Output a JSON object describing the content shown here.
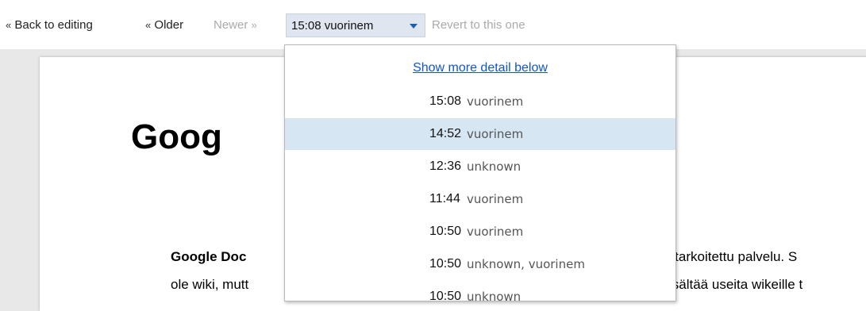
{
  "toolbar": {
    "back_label": "Back to editing",
    "back_arrow": "«",
    "older_label": "Older",
    "older_arrow": "«",
    "newer_label": "Newer",
    "newer_arrow": "»",
    "selected_revision": "15:08 vuorinem",
    "revert_label": "Revert to this one"
  },
  "dropdown": {
    "more_detail_label": "Show more detail below",
    "items": [
      {
        "time": "15:08",
        "who": "vuorinem",
        "highlighted": false
      },
      {
        "time": "14:52",
        "who": "vuorinem",
        "highlighted": true
      },
      {
        "time": "12:36",
        "who": "unknown",
        "highlighted": false
      },
      {
        "time": "11:44",
        "who": "vuorinem",
        "highlighted": false
      },
      {
        "time": "10:50",
        "who": "vuorinem",
        "highlighted": false
      },
      {
        "time": "10:50",
        "who": "unknown, vuorinem",
        "highlighted": false
      },
      {
        "time": "10:50",
        "who": "unknown",
        "highlighted": false
      }
    ]
  },
  "document": {
    "title_visible": "Goog",
    "line1_bold": "Google Doc",
    "line1_right": "n tarkoitettu palvelu. S",
    "line2_left": "ole wiki, mutt",
    "line2_right": "isältää useita wikeille t"
  },
  "colors": {
    "highlight": "#d6e6f3",
    "link": "#1155cc",
    "disabled_text": "#aaaaaa",
    "select_bg": "#dfe6ef"
  }
}
